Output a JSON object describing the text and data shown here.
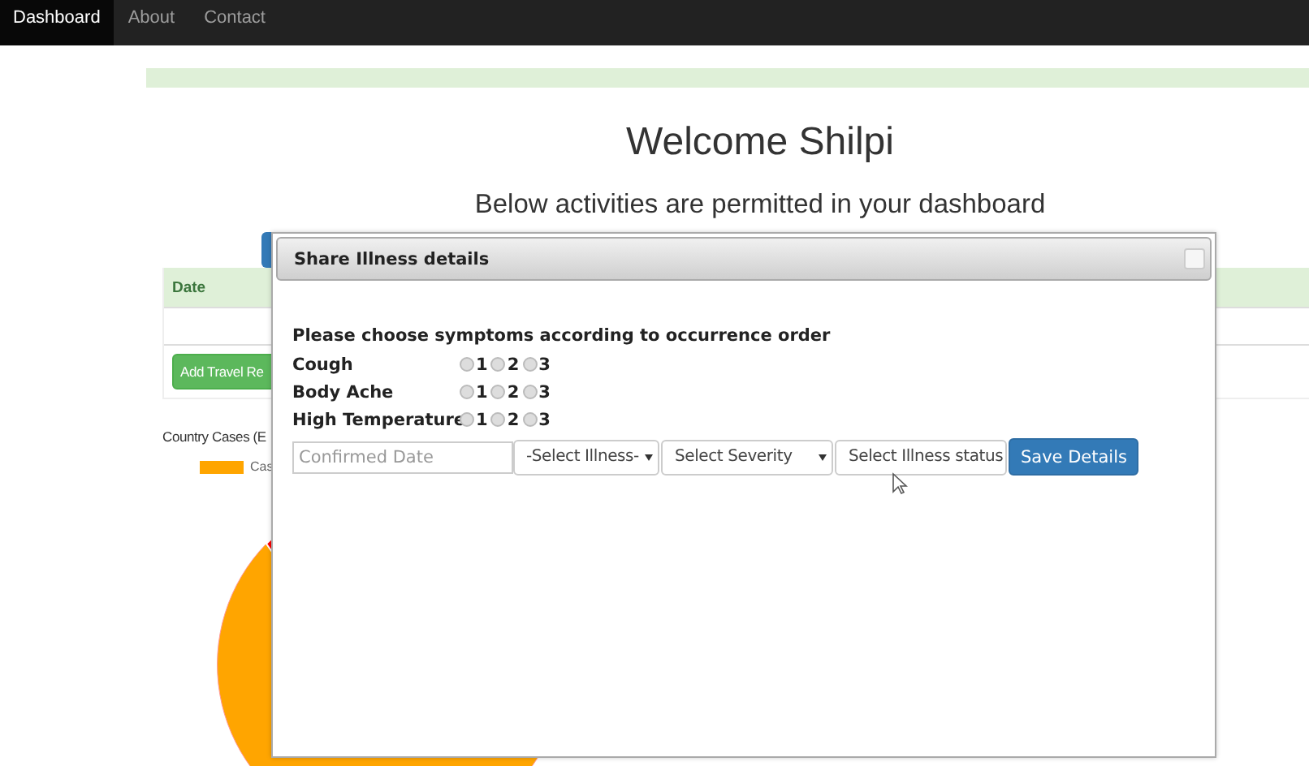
{
  "navbar": {
    "items": [
      {
        "label": "Dashboard",
        "selected": true
      },
      {
        "label": "About",
        "selected": false
      },
      {
        "label": "Contact",
        "selected": false
      }
    ]
  },
  "page": {
    "title": "Welcome Shilpi",
    "subtitle": "Below activities are permitted in your dashboard",
    "table": {
      "columns": [
        "Date"
      ]
    },
    "add_button": "Add Travel Re",
    "chart_title": "Country Cases (E",
    "legend": "Cas"
  },
  "dialog": {
    "title": "Share Illness details",
    "instruction": "Please choose symptoms according to occurrence order",
    "symptoms": [
      {
        "name": "Cough",
        "options": [
          {
            "label": "1",
            "selected": false
          },
          {
            "label": "2",
            "selected": false
          },
          {
            "label": "3",
            "selected": false
          }
        ]
      },
      {
        "name": "Body Ache",
        "options": [
          {
            "label": "1",
            "selected": false
          },
          {
            "label": "2",
            "selected": false
          },
          {
            "label": "3",
            "selected": false
          }
        ]
      },
      {
        "name": "High Temperature",
        "options": [
          {
            "label": "1",
            "selected": false
          },
          {
            "label": "2",
            "selected": false
          },
          {
            "label": "3",
            "selected": false
          }
        ]
      }
    ],
    "date_field": {
      "placeholder": "Confirmed Date"
    },
    "selects": [
      "-Select Illness-",
      "Select Severity",
      "Select Illness status"
    ],
    "save_button": "Save Details"
  }
}
